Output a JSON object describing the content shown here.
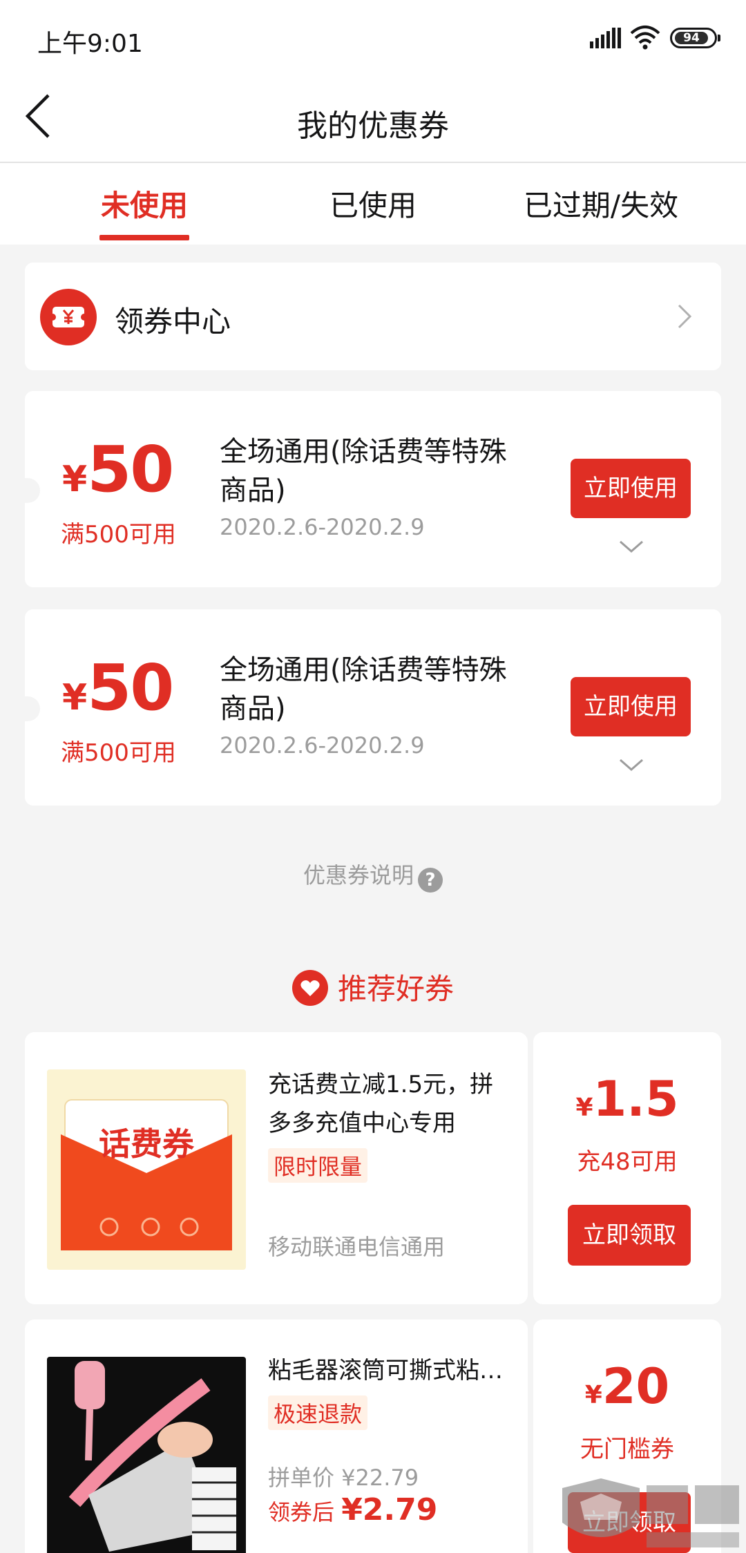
{
  "status_bar": {
    "time": "上午9:01",
    "battery": "94"
  },
  "nav": {
    "title": "我的优惠券"
  },
  "tabs": [
    {
      "label": "未使用",
      "active": true
    },
    {
      "label": "已使用",
      "active": false
    },
    {
      "label": "已过期/失效",
      "active": false
    }
  ],
  "coupon_center": {
    "label": "领券中心",
    "icon": "coupon-yen-icon"
  },
  "coupons": [
    {
      "currency": "¥",
      "amount": "50",
      "threshold": "满500可用",
      "title": "全场通用(除话费等特殊商品)",
      "dates": "2020.2.6-2020.2.9",
      "button": "立即使用"
    },
    {
      "currency": "¥",
      "amount": "50",
      "threshold": "满500可用",
      "title": "全场通用(除话费等特殊商品)",
      "dates": "2020.2.6-2020.2.9",
      "button": "立即使用"
    }
  ],
  "info_link": {
    "label": "优惠券说明",
    "icon": "help-icon"
  },
  "recommend": {
    "heading": "推荐好券",
    "items": [
      {
        "thumb_label": "话费券",
        "desc": "充话费立减1.5元，拼多多充值中心专用",
        "tag": "限时限量",
        "sub": "移动联通电信通用",
        "currency": "¥",
        "value": "1.5",
        "condition": "充48可用",
        "button": "立即领取"
      },
      {
        "desc": "粘毛器滚筒可撕式粘…",
        "tag": "极速退款",
        "group_price": "拼单价 ¥22.79",
        "after_label": "领券后 ",
        "after_price": "¥2.79",
        "currency": "¥",
        "value": "20",
        "condition": "无门槛券",
        "button": "立即领取"
      }
    ]
  },
  "colors": {
    "accent": "#e02e24",
    "background": "#f4f4f4"
  }
}
